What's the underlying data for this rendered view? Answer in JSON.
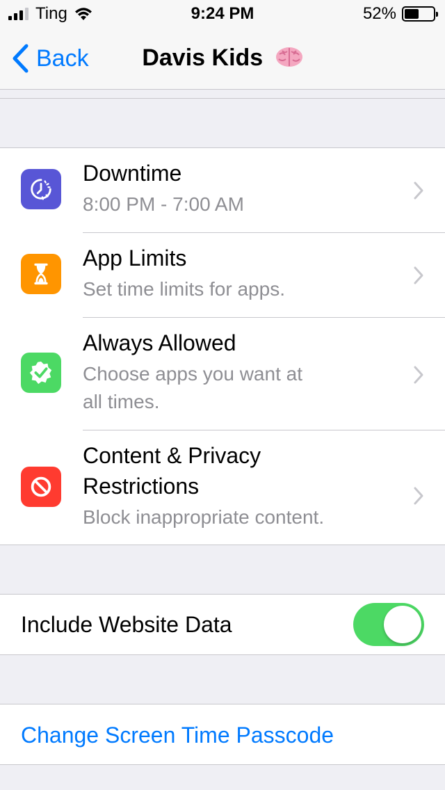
{
  "status_bar": {
    "carrier": "Ting",
    "time": "9:24 PM",
    "battery_percent": "52%",
    "battery_level": 0.52,
    "signal_bars": 3
  },
  "nav": {
    "back_label": "Back",
    "title": "Davis Kids",
    "title_icon": "brain-emoji"
  },
  "settings": {
    "rows": [
      {
        "title": "Downtime",
        "subtitle": "8:00 PM - 7:00 AM",
        "icon": "downtime-icon",
        "color": "#5856d6"
      },
      {
        "title": "App Limits",
        "subtitle": "Set time limits for apps.",
        "icon": "hourglass-icon",
        "color": "#ff9500"
      },
      {
        "title": "Always Allowed",
        "subtitle_line1": "Choose apps you want at",
        "subtitle_line2": "all times.",
        "icon": "checkmark-badge-icon",
        "color": "#4cd964"
      },
      {
        "title_line1": "Content & Privacy",
        "title_line2": "Restrictions",
        "subtitle": "Block inappropriate content.",
        "icon": "prohibited-icon",
        "color": "#ff3b30"
      }
    ]
  },
  "website_data": {
    "label": "Include Website Data",
    "enabled": true,
    "toggle_color": "#4cd964"
  },
  "passcode": {
    "label": "Change Screen Time Passcode",
    "color": "#007aff"
  }
}
